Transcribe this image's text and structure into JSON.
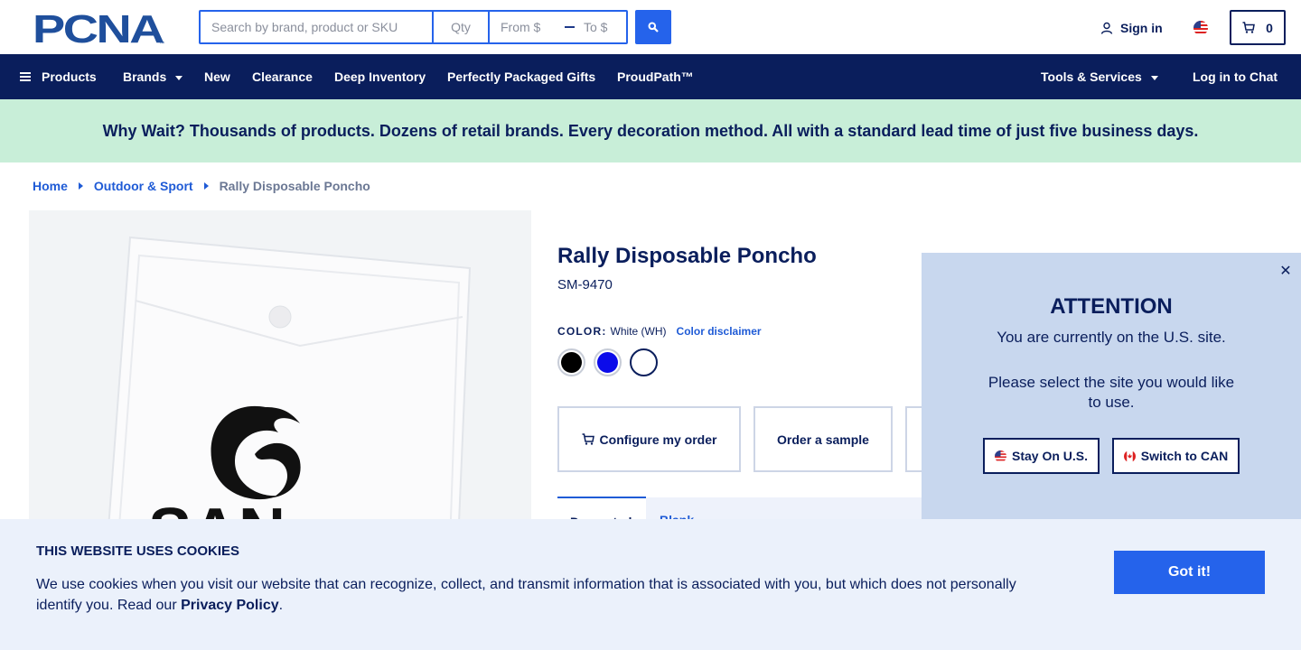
{
  "header": {
    "logo_text": "PCNA",
    "search": {
      "placeholder": "Search by brand, product or SKU",
      "qty_placeholder": "Qty",
      "from_placeholder": "From $",
      "to_placeholder": "To $"
    },
    "sign_in_label": "Sign in",
    "cart_count": "0"
  },
  "nav": {
    "products_label": "Products",
    "items": [
      "Brands",
      "New",
      "Clearance",
      "Deep Inventory",
      "Perfectly Packaged Gifts",
      "ProudPath™"
    ],
    "tools_label": "Tools & Services",
    "chat_label": "Log in to Chat"
  },
  "promo": {
    "text": "Why Wait? Thousands of products. Dozens of retail brands. Every decoration method. All with a standard lead time of just five business days."
  },
  "breadcrumb": [
    "Home",
    "Outdoor & Sport",
    "Rally Disposable Poncho"
  ],
  "product": {
    "title": "Rally Disposable Poncho",
    "sku": "SM-9470",
    "color_label": "COLOR:",
    "color_value": "White (WH)",
    "color_disclaimer": "Color disclaimer",
    "swatches": [
      {
        "name": "Black",
        "hex": "#000000"
      },
      {
        "name": "Royal Blue",
        "hex": "#0b0bea"
      },
      {
        "name": "White",
        "hex": "#ffffff"
      }
    ],
    "image_brand_text": "SAN",
    "actions": {
      "configure_label": "Configure my order",
      "sample_label": "Order a sample"
    },
    "tabs": [
      "Decorated",
      "Blank"
    ]
  },
  "modal": {
    "title": "ATTENTION",
    "message": "You are currently on the U.S. site.",
    "prompt": "Please select the site you would like to use.",
    "stay_label": "Stay On U.S.",
    "switch_label": "Switch to CAN",
    "close_symbol": "✕"
  },
  "cookie": {
    "title": "THIS WEBSITE USES COOKIES",
    "body": "We use cookies when you visit our website that can recognize, collect, and transmit information that is associated with you, but which does not personally identify you. Read our ",
    "policy_link": "Privacy Policy",
    "end": ".",
    "button_label": "Got it!"
  },
  "colors": {
    "brand_navy": "#0a1e5c",
    "accent_blue": "#2563eb",
    "promo_green": "#c8eed8",
    "modal_bg": "#c8d7ee",
    "cookie_bg": "#ebf1fb"
  }
}
